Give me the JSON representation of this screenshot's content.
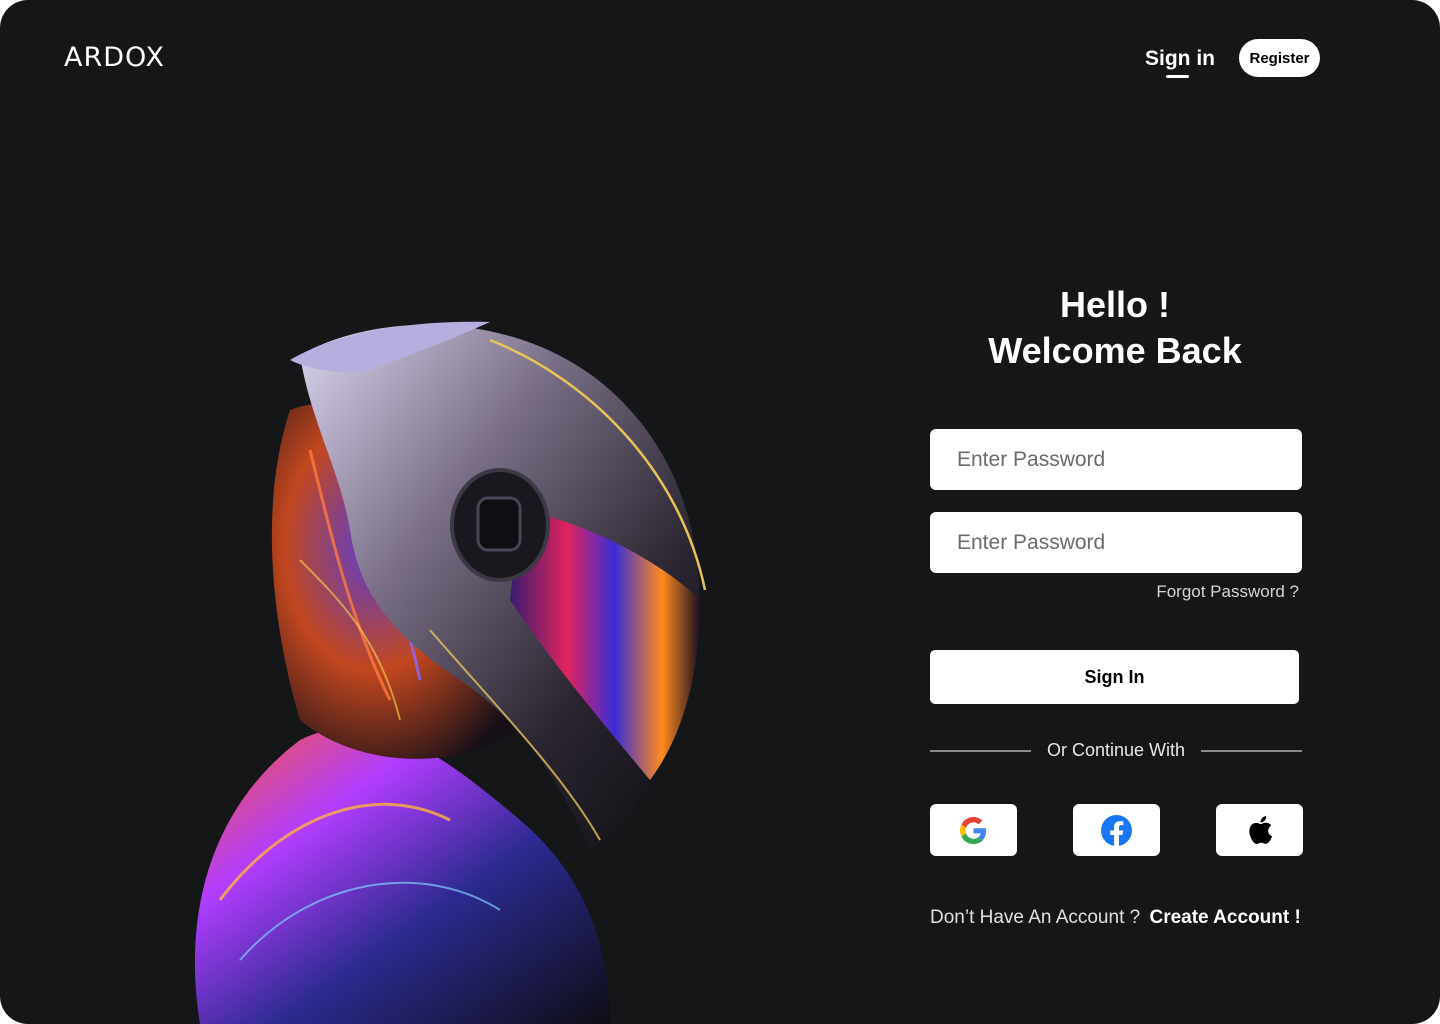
{
  "brand": {
    "logo_text": "ARDOX"
  },
  "nav": {
    "signin_label": "Sign in",
    "register_label": "Register"
  },
  "login": {
    "heading_line1": "Hello !",
    "heading_line2": "Welcome Back",
    "field1_placeholder": "Enter Password",
    "field2_placeholder": "Enter Password",
    "forgot_label": "Forgot Password ?",
    "signin_button_label": "Sign In",
    "divider_text": "Or Continue With",
    "social": [
      {
        "icon": "google-icon"
      },
      {
        "icon": "facebook-icon"
      },
      {
        "icon": "apple-icon"
      }
    ],
    "no_account_text": "Don’t Have An Account ?",
    "create_account_label": "Create Account !"
  },
  "colors": {
    "background": "#151618",
    "text_primary": "#ffffff",
    "facebook_blue": "#1877F2"
  }
}
